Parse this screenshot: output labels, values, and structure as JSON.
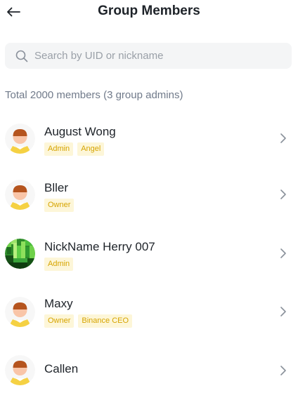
{
  "header": {
    "title": "Group Members",
    "back_icon": "arrow-left-icon"
  },
  "search": {
    "placeholder": "Search by UID or nickname",
    "value": ""
  },
  "summary": {
    "total_text": "Total 2000 members (3 group admins)"
  },
  "colors": {
    "badge_bg": "#fdf6d8",
    "badge_text": "#d6a400",
    "avatar_yellow": "#f5d143",
    "avatar_hair": "#b5541e",
    "avatar_skin": "#f9c5a8"
  },
  "members": [
    {
      "name": "August Wong",
      "avatar": "default-avatar",
      "badges": [
        "Admin",
        "Angel"
      ]
    },
    {
      "name": "Bller",
      "avatar": "default-avatar",
      "badges": [
        "Owner"
      ]
    },
    {
      "name": "NickName Herry 007",
      "avatar": "green-pixel-avatar",
      "badges": [
        "Admin"
      ]
    },
    {
      "name": "Maxy",
      "avatar": "default-avatar",
      "badges": [
        "Owner",
        "Binance CEO"
      ]
    },
    {
      "name": "Callen",
      "avatar": "default-avatar",
      "badges": []
    }
  ]
}
